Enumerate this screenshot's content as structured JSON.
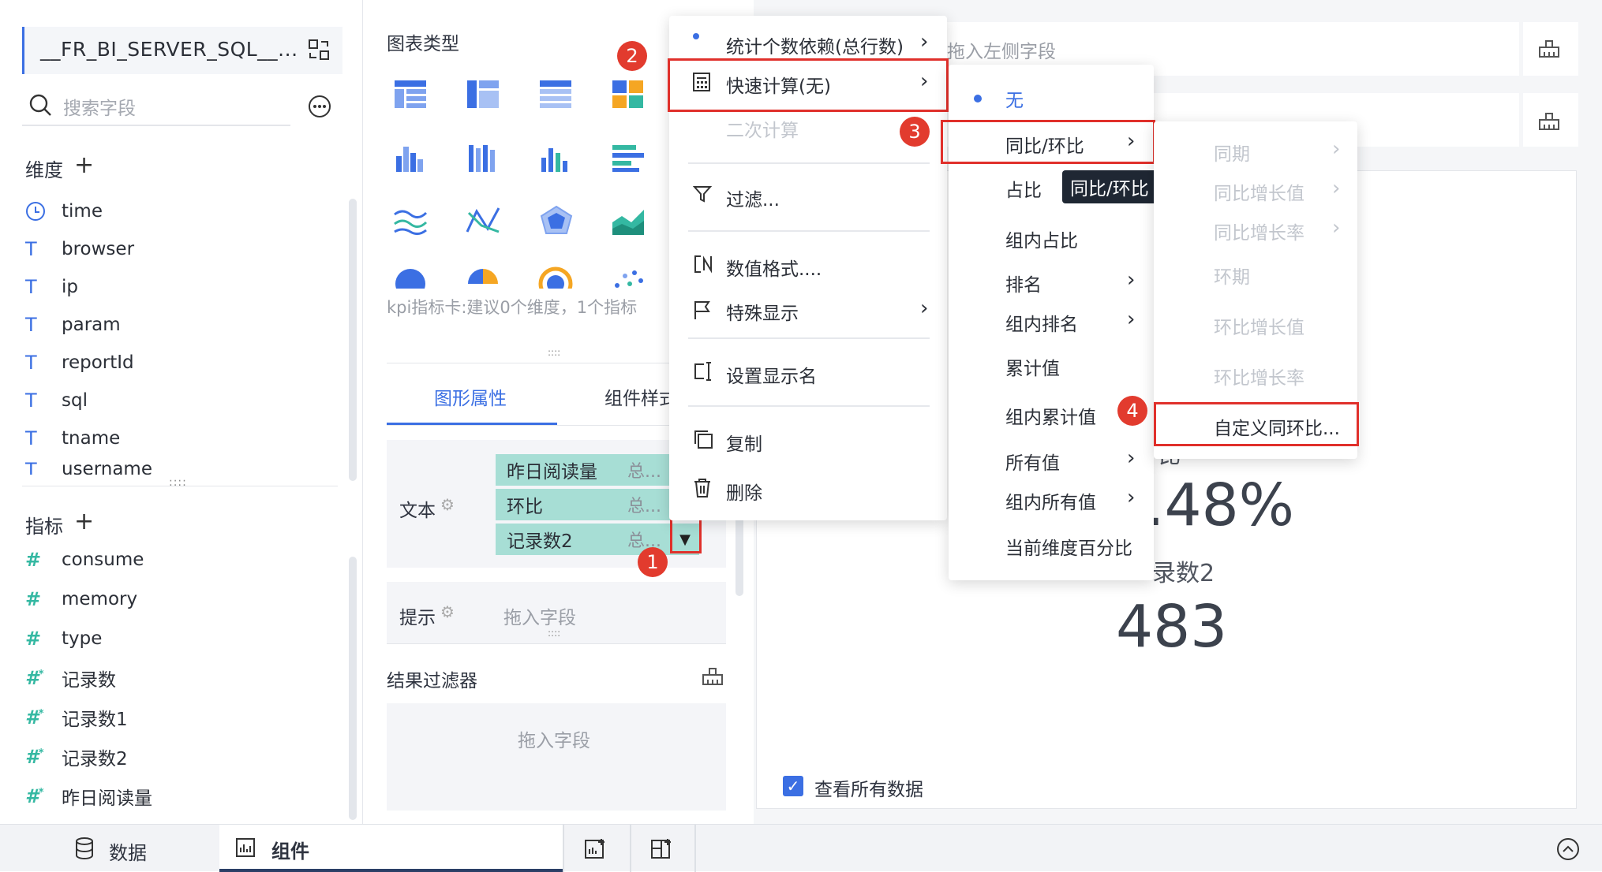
{
  "left_panel": {
    "datasource": "__FR_BI_SERVER_SQL__...",
    "search_placeholder": "搜索字段",
    "dimension_header": "维度",
    "dimensions": [
      "time",
      "browser",
      "ip",
      "param",
      "reportId",
      "sql",
      "tname",
      "username"
    ],
    "measure_header": "指标",
    "measures": [
      "consume",
      "memory",
      "type",
      "记录数",
      "记录数1",
      "记录数2",
      "昨日阅读量"
    ]
  },
  "chart_panel": {
    "chart_type_label": "图表类型",
    "kpi_hint": "kpi指标卡:建议0个维度，1个指标",
    "tab_shape": "图形属性",
    "tab_component": "组件样式",
    "text_label": "文本",
    "text_fields": [
      "昨日阅读量",
      "环比",
      "记录数2"
    ],
    "field_sub": "总...",
    "tip_label": "提示",
    "drag_field": "拖入字段",
    "result_filter": "结果过滤器",
    "drag_field_2": "拖入字段"
  },
  "canvas": {
    "drop_hint": "拖入左侧字段",
    "kpi_value_1": ".48%",
    "kpi_label_2": "录数2",
    "kpi_value_2": "483",
    "partial_label": "比",
    "view_all_data": "查看所有数据"
  },
  "menu1": {
    "item_count": "统计个数依赖(总行数)",
    "item_quick_calc": "快速计算(无)",
    "item_secondary": "二次计算",
    "item_filter": "过滤...",
    "item_format": "数值格式....",
    "item_special": "特殊显示",
    "item_display_name": "设置显示名",
    "item_copy": "复制",
    "item_delete": "删除"
  },
  "menu2": {
    "none": "无",
    "yoy": "同比/环比",
    "ratio": "占比",
    "group_ratio": "组内占比",
    "rank": "排名",
    "group_rank": "组内排名",
    "cumulative": "累计值",
    "group_cumulative": "组内累计值",
    "all_values": "所有值",
    "group_all": "组内所有值",
    "dim_percent": "当前维度百分比"
  },
  "menu3": {
    "same_period": "同期",
    "yoy_value": "同比增长值",
    "yoy_rate": "同比增长率",
    "prev_period": "环期",
    "mom_value": "环比增长值",
    "mom_rate": "环比增长率",
    "custom": "自定义同环比..."
  },
  "tooltip": "同比/环比",
  "badges": [
    "1",
    "2",
    "3",
    "4"
  ],
  "bottom_bar": {
    "data_tab": "数据",
    "component_tab": "组件"
  },
  "colors": {
    "accent": "#3b6fe3",
    "measure_icon": "#34b8a2",
    "pill": "#a7ded5",
    "annotation_red": "#e0302b"
  }
}
